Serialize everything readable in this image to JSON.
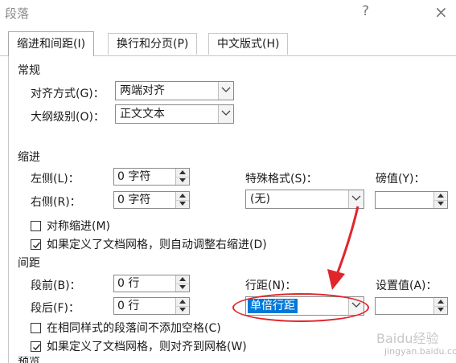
{
  "window": {
    "title": "段落",
    "help": "?",
    "close": "×"
  },
  "tabs": [
    {
      "label": "缩进和间距(I)"
    },
    {
      "label": "换行和分页(P)"
    },
    {
      "label": "中文版式(H)"
    }
  ],
  "general": {
    "heading": "常规",
    "alignment_label": "对齐方式(G)：",
    "alignment_value": "两端对齐",
    "outline_label": "大纲级别(O)：",
    "outline_value": "正文文本"
  },
  "indent": {
    "heading": "缩进",
    "left_label": "左侧(L)：",
    "left_value": "0 字符",
    "right_label": "右侧(R)：",
    "right_value": "0 字符",
    "special_label": "特殊格式(S)：",
    "special_value": "(无)",
    "by_label": "磅值(Y)：",
    "by_value": "",
    "mirror_label": "对称缩进(M)",
    "mirror_checked": false,
    "autoright_label": "如果定义了文档网格，则自动调整右缩进(D)",
    "autoright_checked": true
  },
  "spacing": {
    "heading": "间距",
    "before_label": "段前(B)：",
    "before_value": "0 行",
    "after_label": "段后(F)：",
    "after_value": "0 行",
    "line_label": "行距(N)：",
    "line_value": "单倍行距",
    "at_label": "设置值(A)：",
    "at_value": "",
    "noadd_label": "在相同样式的段落间不添加空格(C)",
    "noadd_checked": false,
    "snap_label": "如果定义了文档网格，则对齐到网格(W)",
    "snap_checked": true
  },
  "next_heading": "预览",
  "watermark": {
    "brand": "Baidu经验",
    "url": "jingyan.baidu.com"
  },
  "colors": {
    "accent": "#0078d7",
    "annotation": "#e0262b"
  }
}
